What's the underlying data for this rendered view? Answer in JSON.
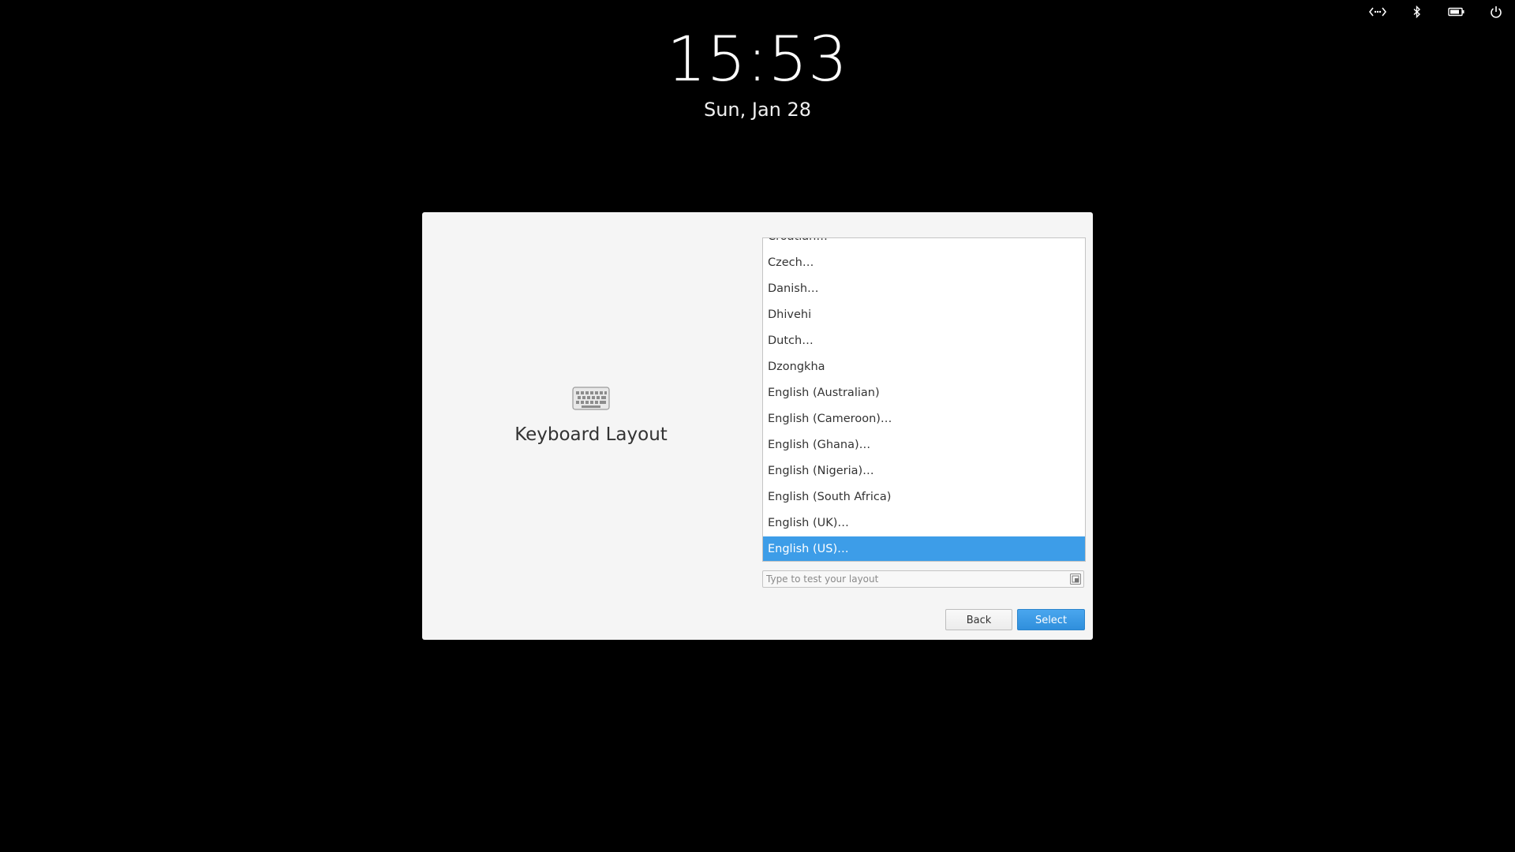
{
  "tray": {
    "icons": [
      "network-icon",
      "bluetooth-icon",
      "battery-icon",
      "power-icon"
    ]
  },
  "lock": {
    "time": "15:53",
    "date": "Sun, Jan 28"
  },
  "dialog": {
    "title": "Keyboard Layout",
    "icon": "keyboard-icon",
    "layouts": [
      "Croatian…",
      "Czech…",
      "Danish…",
      "Dhivehi",
      "Dutch…",
      "Dzongkha",
      "English (Australian)",
      "English (Cameroon)…",
      "English (Ghana)…",
      "English (Nigeria)…",
      "English (South Africa)",
      "English (UK)…",
      "English (US)…"
    ],
    "selected_layout": "English (US)…",
    "test_input": {
      "value": "",
      "placeholder": "Type to test your layout"
    },
    "back_label": "Back",
    "select_label": "Select"
  },
  "colors": {
    "accent": "#3d9de8",
    "background": "#000000",
    "dialog_bg": "#f5f5f5"
  }
}
